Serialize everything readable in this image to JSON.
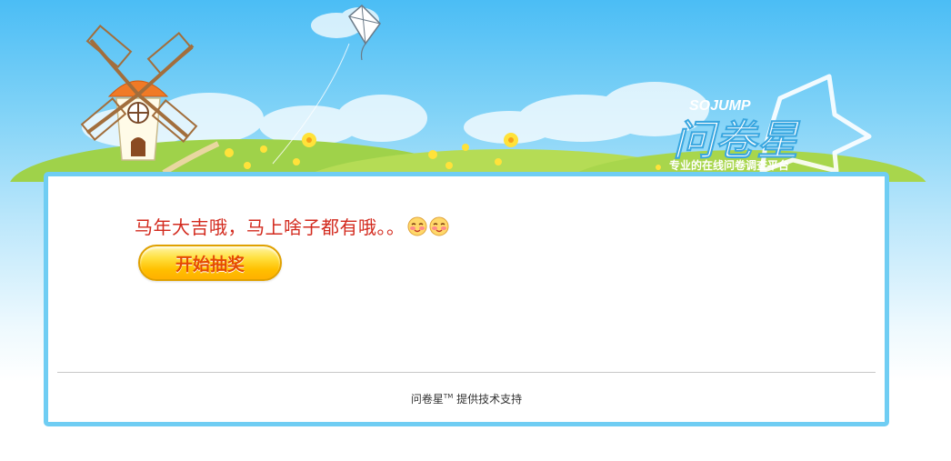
{
  "logo": {
    "brand_en": "SOJUMP",
    "brand_cn": "问卷星",
    "tagline": "专业的在线问卷调查平台"
  },
  "content": {
    "message": "马年大吉哦，马上啥子都有哦。。",
    "emoji_icons": [
      "blush-face-icon",
      "blush-face-icon"
    ]
  },
  "actions": {
    "start_label": "开始抽奖"
  },
  "footer": {
    "brand": "问卷星",
    "tm": "TM",
    "text": "提供技术支持"
  },
  "colors": {
    "sky": "#4bbdf5",
    "panel_border": "#6fcdf3",
    "message": "#d32a1e",
    "button_text": "#e54b00",
    "button_fill": "#ffc000"
  }
}
